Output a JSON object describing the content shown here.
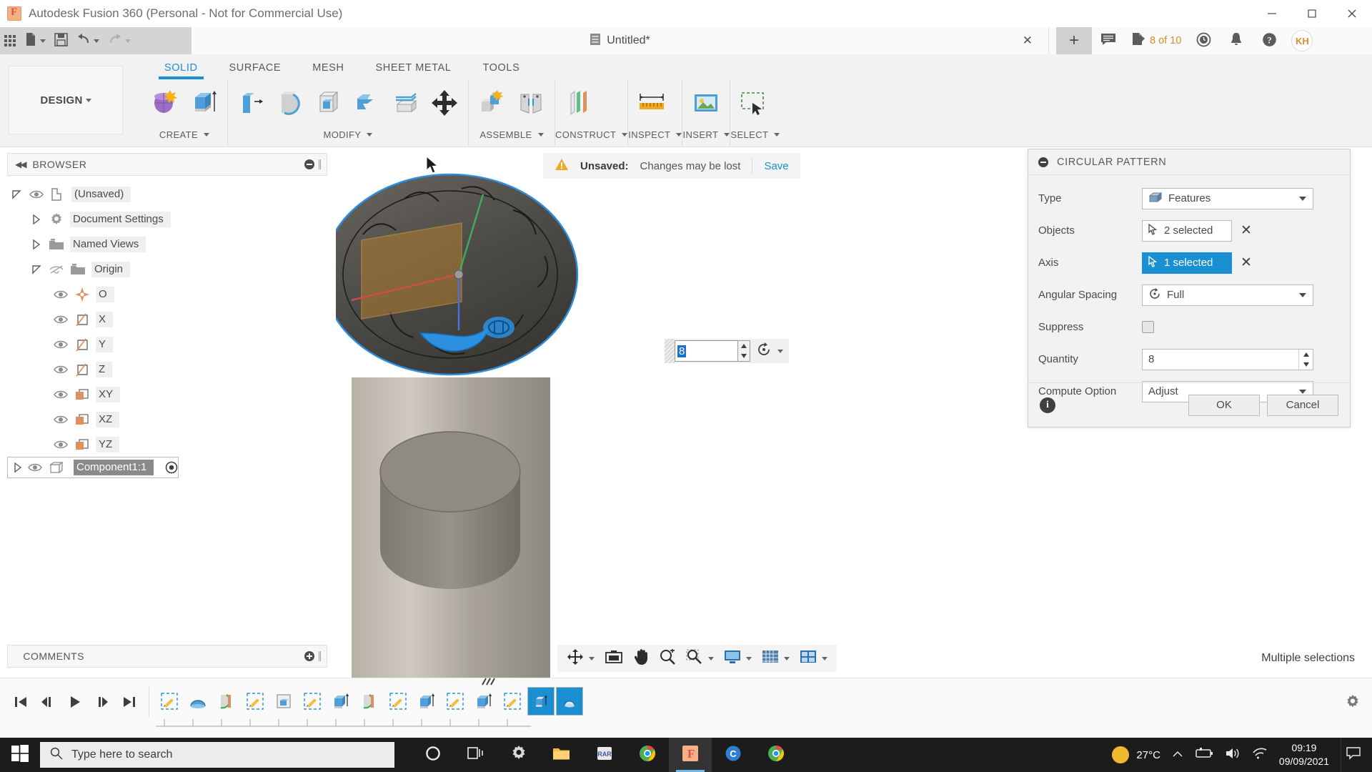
{
  "window": {
    "title": "Autodesk Fusion 360 (Personal - Not for Commercial Use)",
    "minimize": "−",
    "maximize": "□",
    "close": "✕"
  },
  "quickbar": {
    "grid_icon": "apps-grid-icon",
    "new_icon": "new-document-icon",
    "save_icon": "save-icon",
    "undo_icon": "undo-icon",
    "redo_icon": "redo-icon"
  },
  "doctab": {
    "title": "Untitled*",
    "doc_icon": "document-icon",
    "close": "✕",
    "new_tab": "+"
  },
  "tray": {
    "comments_icon": "comments-icon",
    "jobs_icon": "jobs-icon",
    "jobs_text": "8 of 10",
    "history_icon": "clock-icon",
    "notifications_icon": "bell-icon",
    "help_icon": "help-icon",
    "avatar_initials": "KH"
  },
  "ribbon": {
    "workspace_button": "DESIGN",
    "tabs": [
      {
        "label": "SOLID",
        "active": true
      },
      {
        "label": "SURFACE",
        "active": false
      },
      {
        "label": "MESH",
        "active": false
      },
      {
        "label": "SHEET METAL",
        "active": false
      },
      {
        "label": "TOOLS",
        "active": false
      }
    ],
    "panels": [
      {
        "label": "CREATE",
        "dropdown": true
      },
      {
        "label": "MODIFY",
        "dropdown": true
      },
      {
        "label": "ASSEMBLE",
        "dropdown": true
      },
      {
        "label": "CONSTRUCT",
        "dropdown": true
      },
      {
        "label": "INSPECT",
        "dropdown": true
      },
      {
        "label": "INSERT",
        "dropdown": true
      },
      {
        "label": "SELECT",
        "dropdown": true
      }
    ]
  },
  "browser": {
    "title": "BROWSER",
    "collapse_icon": "collapse-left-icon",
    "minimize_icon": "minimize-panel-icon",
    "items": [
      {
        "label": "(Unsaved)",
        "indent": 0,
        "twist": "open",
        "eye": "visible",
        "icon": "component-icon",
        "selected": false
      },
      {
        "label": "Document Settings",
        "indent": 1,
        "twist": "closed",
        "eye": "none",
        "icon": "gear-icon",
        "selected": false
      },
      {
        "label": "Named Views",
        "indent": 1,
        "twist": "closed",
        "eye": "none",
        "icon": "folder-icon",
        "selected": false
      },
      {
        "label": "Origin",
        "indent": 1,
        "twist": "open",
        "eye": "hidden",
        "icon": "folder-icon",
        "selected": false
      },
      {
        "label": "O",
        "indent": 2,
        "twist": "none",
        "eye": "visible",
        "icon": "origin-point-icon",
        "selected": false
      },
      {
        "label": "X",
        "indent": 2,
        "twist": "none",
        "eye": "visible",
        "icon": "axis-icon",
        "selected": false
      },
      {
        "label": "Y",
        "indent": 2,
        "twist": "none",
        "eye": "visible",
        "icon": "axis-icon",
        "selected": false
      },
      {
        "label": "Z",
        "indent": 2,
        "twist": "none",
        "eye": "visible",
        "icon": "axis-icon",
        "selected": false
      },
      {
        "label": "XY",
        "indent": 2,
        "twist": "none",
        "eye": "visible",
        "icon": "plane-icon",
        "selected": false
      },
      {
        "label": "XZ",
        "indent": 2,
        "twist": "none",
        "eye": "visible",
        "icon": "plane-icon",
        "selected": false
      },
      {
        "label": "YZ",
        "indent": 2,
        "twist": "none",
        "eye": "visible",
        "icon": "plane-icon",
        "selected": false
      },
      {
        "label": "Component1:1",
        "indent": 0,
        "twist": "closed",
        "eye": "visible",
        "icon": "body-icon",
        "selected": true,
        "activate_icon": "activate-component-icon"
      }
    ]
  },
  "comments": {
    "title": "COMMENTS",
    "add_icon": "add-comment-icon"
  },
  "canvas": {
    "unsaved": {
      "warn_icon": "warning-icon",
      "label": "Unsaved:",
      "message": "Changes may be lost",
      "save_link": "Save"
    },
    "inline_editor": {
      "value": "8",
      "drag_handle": "drag-handle-icon",
      "up": "▲",
      "down": "▼",
      "type_icon": "circular-pattern-icon",
      "dropdown": "▼"
    },
    "status_text": "Multiple selections",
    "navbar": [
      {
        "icon": "orbit-icon",
        "dropdown": true
      },
      {
        "icon": "look-at-icon",
        "dropdown": false
      },
      {
        "icon": "pan-icon",
        "dropdown": false
      },
      {
        "icon": "zoom-icon",
        "dropdown": false
      },
      {
        "icon": "fit-icon",
        "dropdown": true
      },
      {
        "icon": "display-settings-icon",
        "dropdown": true
      },
      {
        "icon": "grid-snap-icon",
        "dropdown": true
      },
      {
        "icon": "viewports-icon",
        "dropdown": true
      }
    ]
  },
  "dialog": {
    "title": "CIRCULAR PATTERN",
    "collapse_icon": "collapse-dialog-icon",
    "fields": [
      {
        "name": "type",
        "label": "Type",
        "control": "select",
        "value": "Features",
        "icon": "features-icon"
      },
      {
        "name": "objects",
        "label": "Objects",
        "control": "selection",
        "value": "2 selected",
        "icon": "cursor-icon",
        "active": false,
        "clear": "✕"
      },
      {
        "name": "axis",
        "label": "Axis",
        "control": "selection",
        "value": "1 selected",
        "icon": "cursor-icon",
        "active": true,
        "clear": "✕"
      },
      {
        "name": "angular",
        "label": "Angular Spacing",
        "control": "select",
        "value": "Full",
        "icon": "angular-spacing-icon"
      },
      {
        "name": "suppress",
        "label": "Suppress",
        "control": "checkbox",
        "value": "",
        "checked": false
      },
      {
        "name": "quantity",
        "label": "Quantity",
        "control": "spinbox",
        "value": "8"
      },
      {
        "name": "compute",
        "label": "Compute Option",
        "control": "select",
        "value": "Adjust",
        "icon": ""
      }
    ],
    "info_icon": "info-icon",
    "ok_label": "OK",
    "cancel_label": "Cancel"
  },
  "timeline": {
    "playback": [
      {
        "icon": "go-to-beginning-icon"
      },
      {
        "icon": "step-back-icon"
      },
      {
        "icon": "play-icon"
      },
      {
        "icon": "step-forward-icon"
      },
      {
        "icon": "go-to-end-icon"
      }
    ],
    "features": [
      {
        "icon": "sketch-icon",
        "selected": false
      },
      {
        "icon": "revolve-icon",
        "selected": false
      },
      {
        "icon": "fillet-icon",
        "selected": false
      },
      {
        "icon": "sketch-icon",
        "selected": false
      },
      {
        "icon": "shell-icon",
        "selected": false
      },
      {
        "icon": "sketch-icon",
        "selected": false
      },
      {
        "icon": "extrude-icon",
        "selected": false
      },
      {
        "icon": "fillet-icon",
        "selected": false
      },
      {
        "icon": "sketch-icon",
        "selected": false
      },
      {
        "icon": "extrude-icon",
        "selected": false
      },
      {
        "icon": "sketch-icon",
        "selected": false
      },
      {
        "icon": "extrude-icon",
        "selected": false,
        "marker": "///"
      },
      {
        "icon": "sketch-icon",
        "selected": false
      },
      {
        "icon": "extrude-icon",
        "selected": true
      },
      {
        "icon": "revolve-icon",
        "selected": true
      }
    ],
    "settings_icon": "timeline-settings-icon"
  },
  "taskbar": {
    "start_icon": "windows-start-icon",
    "search_icon": "search-icon",
    "search_placeholder": "Type here to search",
    "apps": [
      {
        "icon": "cortana-icon",
        "active": false
      },
      {
        "icon": "task-view-icon",
        "active": false
      },
      {
        "icon": "settings-gear-icon",
        "active": false
      },
      {
        "icon": "file-explorer-icon",
        "active": false
      },
      {
        "icon": "winrar-icon",
        "active": false
      },
      {
        "icon": "chrome-icon",
        "active": false
      },
      {
        "icon": "fusion360-icon",
        "active": true
      },
      {
        "icon": "teams-icon",
        "active": false
      },
      {
        "icon": "chrome-icon",
        "active": false
      }
    ],
    "weather_temp": "27°C",
    "weather_icon": "sunny-icon",
    "tray_up_icon": "show-hidden-icons",
    "battery_icon": "battery-charging-icon",
    "volume_icon": "volume-icon",
    "network_icon": "wifi-icon",
    "time": "09:19",
    "date": "09/09/2021",
    "action_center_icon": "action-center-icon"
  },
  "colors": {
    "accent_blue": "#1a8fd1",
    "orange": "#d78a2e",
    "warning": "#f0a826",
    "panel_bg": "#f2f2f2",
    "taskbar_bg": "#1c1c1c"
  }
}
